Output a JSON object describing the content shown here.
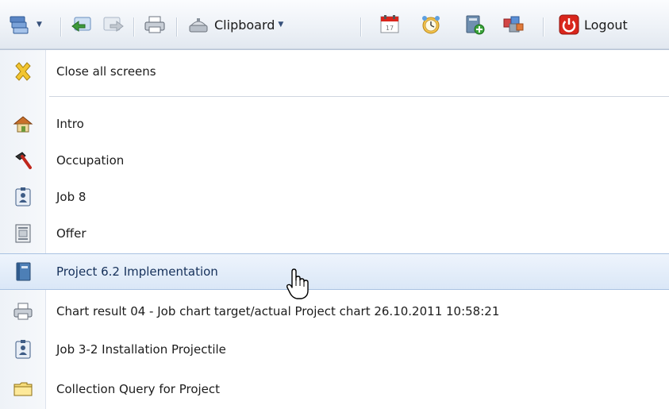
{
  "toolbar": {
    "clipboard_label": "Clipboard",
    "logout_label": "Logout",
    "icons": [
      "screens-menu-icon",
      "back-icon",
      "forward-icon",
      "print-icon",
      "clipboard-icon",
      "calendar-icon",
      "alarm-clock-icon",
      "new-document-icon",
      "modules-icon",
      "power-icon"
    ]
  },
  "menu": {
    "items": [
      {
        "label": "Close all screens",
        "icon": "close-x-icon"
      },
      {
        "label": "Intro",
        "icon": "home-icon"
      },
      {
        "label": "Occupation",
        "icon": "hammer-icon"
      },
      {
        "label": "Job 8",
        "icon": "job-badge-icon"
      },
      {
        "label": "Offer",
        "icon": "offer-document-icon"
      },
      {
        "label": "Project 6.2 Implementation",
        "icon": "project-book-icon",
        "highlighted": true
      },
      {
        "label": "Chart result 04 - Job chart target/actual Project chart 26.10.2011 10:58:21",
        "icon": "print-icon"
      },
      {
        "label": "Job 3-2 Installation Projectile",
        "icon": "job-badge-icon"
      },
      {
        "label": "Collection Query for Project",
        "icon": "folder-icon"
      }
    ]
  },
  "colors": {
    "toolbar_bg": "#eef2f7",
    "highlight_bg": "#dae7f7",
    "highlight_border": "#a9c2e2",
    "logout_red": "#d9261c"
  }
}
